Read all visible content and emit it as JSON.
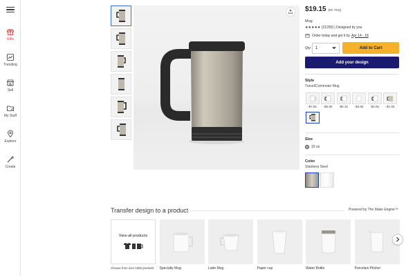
{
  "nav": {
    "items": [
      {
        "label": "Gifts",
        "icon": "gift-icon",
        "active": true
      },
      {
        "label": "Trending",
        "icon": "trending-icon"
      },
      {
        "label": "Sell",
        "icon": "store-icon"
      },
      {
        "label": "My Stuff",
        "icon": "folder-icon"
      },
      {
        "label": "Explore",
        "icon": "location-pin-icon"
      },
      {
        "label": "Create",
        "icon": "magic-wand-icon"
      }
    ]
  },
  "product": {
    "price": "$19.15",
    "per": "per mug",
    "name": "Mug",
    "rating": "★★★★★ (21290) | Designed by you",
    "ship_text": "Order today and get it by",
    "ship_date": "Apr 14 - 18",
    "qty_label": "Qty:",
    "qty_value": "1",
    "add_to_cart": "Add to Cart",
    "add_design": "Add your design",
    "style_title": "Style",
    "style_selected": "Travel/Commuter Mug",
    "style_options": [
      {
        "price": "-$7.65"
      },
      {
        "price": "-$6.90"
      },
      {
        "price": "-$6.15"
      },
      {
        "price": "-$3.85"
      },
      {
        "price": "-$3.05"
      },
      {
        "price": "-$1.55"
      },
      {
        "price": ""
      }
    ],
    "size_title": "Size",
    "size_value": "15 oz",
    "color_title": "Color",
    "color_value": "Stainless Steel"
  },
  "transfer": {
    "title": "Transfer design to a product",
    "powered": "Powered by The Make Engine™",
    "view_all": "View all products",
    "view_all_caption": "Choose from over 1000 products",
    "products": [
      {
        "label": "Specialty Mug"
      },
      {
        "label": "Latte Mug"
      },
      {
        "label": "Paper cup"
      },
      {
        "label": "Water Bottle"
      },
      {
        "label": "Porcelain Pitcher"
      }
    ]
  }
}
